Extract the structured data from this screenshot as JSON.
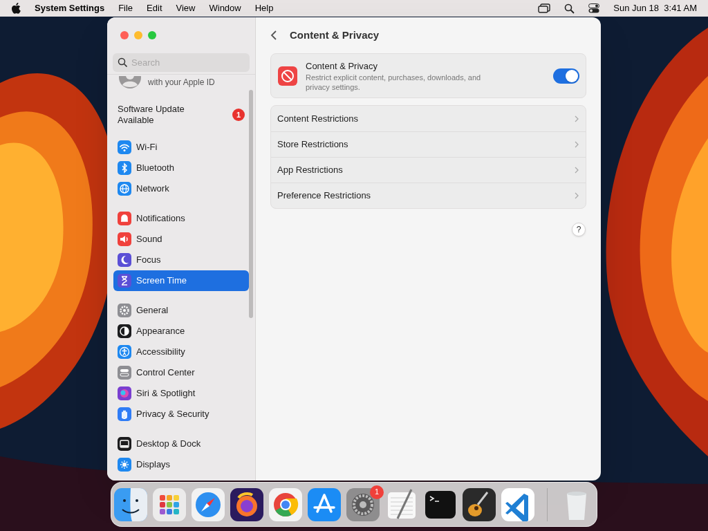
{
  "menu_bar": {
    "app": "System Settings",
    "menus": [
      "File",
      "Edit",
      "View",
      "Window",
      "Help"
    ],
    "clock": "Sun Jun 18  3:41 AM"
  },
  "sidebar": {
    "search": {
      "placeholder": "Search"
    },
    "account_subtitle": "with your Apple ID",
    "update": {
      "label": "Software Update Available",
      "badge": "1"
    },
    "groups": [
      [
        {
          "label": "Wi-Fi",
          "color": "#1e88f0",
          "selected": false
        },
        {
          "label": "Bluetooth",
          "color": "#1e88f0",
          "selected": false
        },
        {
          "label": "Network",
          "color": "#1e88f0",
          "selected": false
        }
      ],
      [
        {
          "label": "Notifications",
          "color": "#f0413c",
          "selected": false
        },
        {
          "label": "Sound",
          "color": "#f0413c",
          "selected": false
        },
        {
          "label": "Focus",
          "color": "#5b4fd6",
          "selected": false
        },
        {
          "label": "Screen Time",
          "color": "#5b4fd6",
          "selected": true
        }
      ],
      [
        {
          "label": "General",
          "color": "#8e8e93",
          "selected": false
        },
        {
          "label": "Appearance",
          "color": "#1c1c1e",
          "selected": false
        },
        {
          "label": "Accessibility",
          "color": "#1e88f0",
          "selected": false
        },
        {
          "label": "Control Center",
          "color": "#8e8e93",
          "selected": false
        },
        {
          "label": "Siri & Spotlight",
          "color": "#7a3fd0",
          "selected": false
        },
        {
          "label": "Privacy & Security",
          "color": "#2f7cf6",
          "selected": false
        }
      ],
      [
        {
          "label": "Desktop & Dock",
          "color": "#1c1c1e",
          "selected": false
        },
        {
          "label": "Displays",
          "color": "#1e88f0",
          "selected": false
        }
      ]
    ]
  },
  "content": {
    "title": "Content & Privacy",
    "card": {
      "title": "Content & Privacy",
      "description": "Restrict explicit content, purchases, downloads, and privacy settings.",
      "on": true
    },
    "rows": [
      "Content Restrictions",
      "Store Restrictions",
      "App Restrictions",
      "Preference Restrictions"
    ],
    "help": "?"
  },
  "dock": [
    {
      "kind": "finder"
    },
    {
      "kind": "launchpad"
    },
    {
      "kind": "safari"
    },
    {
      "kind": "firefox"
    },
    {
      "kind": "chrome"
    },
    {
      "kind": "appstore"
    },
    {
      "kind": "settings",
      "badge": "1"
    },
    {
      "kind": "textedit"
    },
    {
      "kind": "terminal"
    },
    {
      "kind": "garageband"
    },
    {
      "kind": "vscode"
    },
    {
      "kind": "trash"
    }
  ]
}
